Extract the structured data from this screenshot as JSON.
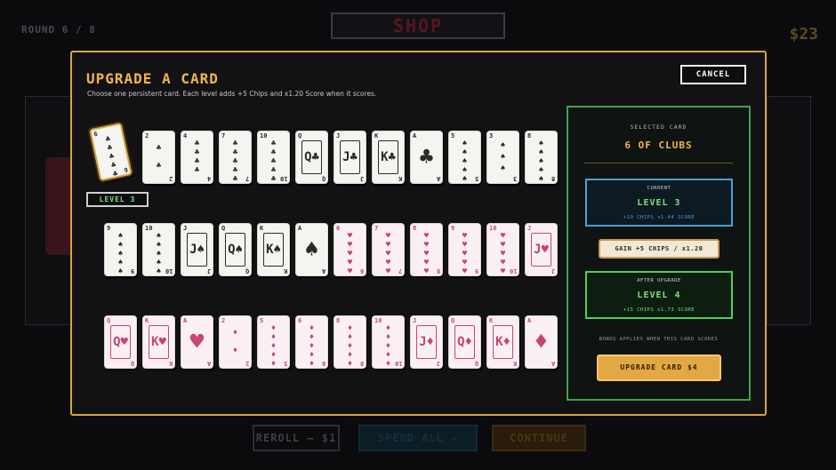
{
  "background": {
    "round": "ROUND 6 / 8",
    "shop_title": "SHOP",
    "money": "$23",
    "reroll": "REROLL — $1",
    "sell": "SPEND ALL →",
    "continue": "CONTINUE"
  },
  "modal": {
    "title": "UPGRADE A CARD",
    "subtitle": "Choose one persistent card. Each level adds +5 Chips and x1.20 Score when it scores.",
    "cancel": "CANCEL",
    "selected_level_tag": "LEVEL 3"
  },
  "cards": {
    "row1": [
      {
        "rank": "6",
        "suit": "♣",
        "color": "black",
        "kind": "pips",
        "pips": 6,
        "selected": true
      },
      {
        "rank": "2",
        "suit": "♣",
        "color": "black",
        "kind": "pips",
        "pips": 2
      },
      {
        "rank": "4",
        "suit": "♣",
        "color": "black",
        "kind": "pips",
        "pips": 4
      },
      {
        "rank": "7",
        "suit": "♣",
        "color": "black",
        "kind": "pips",
        "pips": 7
      },
      {
        "rank": "10",
        "suit": "♣",
        "color": "black",
        "kind": "pips",
        "pips": 10
      },
      {
        "rank": "Q",
        "suit": "♣",
        "color": "black",
        "kind": "face"
      },
      {
        "rank": "J",
        "suit": "♣",
        "color": "black",
        "kind": "face"
      },
      {
        "rank": "K",
        "suit": "♣",
        "color": "black",
        "kind": "face"
      },
      {
        "rank": "A",
        "suit": "♣",
        "color": "black",
        "kind": "ace"
      },
      {
        "rank": "5",
        "suit": "♠",
        "color": "black",
        "kind": "pips",
        "pips": 5
      },
      {
        "rank": "3",
        "suit": "♠",
        "color": "black",
        "kind": "pips",
        "pips": 3
      },
      {
        "rank": "8",
        "suit": "♠",
        "color": "black",
        "kind": "pips",
        "pips": 8
      }
    ],
    "row2": [
      {
        "rank": "9",
        "suit": "♠",
        "color": "black",
        "kind": "pips",
        "pips": 9
      },
      {
        "rank": "10",
        "suit": "♠",
        "color": "black",
        "kind": "pips",
        "pips": 10
      },
      {
        "rank": "J",
        "suit": "♠",
        "color": "black",
        "kind": "face"
      },
      {
        "rank": "Q",
        "suit": "♠",
        "color": "black",
        "kind": "face"
      },
      {
        "rank": "K",
        "suit": "♠",
        "color": "black",
        "kind": "face"
      },
      {
        "rank": "A",
        "suit": "♠",
        "color": "black",
        "kind": "ace"
      },
      {
        "rank": "6",
        "suit": "♥",
        "color": "red",
        "kind": "pips",
        "pips": 6
      },
      {
        "rank": "7",
        "suit": "♥",
        "color": "red",
        "kind": "pips",
        "pips": 7
      },
      {
        "rank": "8",
        "suit": "♥",
        "color": "red",
        "kind": "pips",
        "pips": 8
      },
      {
        "rank": "9",
        "suit": "♥",
        "color": "red",
        "kind": "pips",
        "pips": 9
      },
      {
        "rank": "10",
        "suit": "♥",
        "color": "red",
        "kind": "pips",
        "pips": 10
      },
      {
        "rank": "J",
        "suit": "♥",
        "color": "red",
        "kind": "face"
      }
    ],
    "row3": [
      {
        "rank": "Q",
        "suit": "♥",
        "color": "red",
        "kind": "face"
      },
      {
        "rank": "K",
        "suit": "♥",
        "color": "red",
        "kind": "face"
      },
      {
        "rank": "A",
        "suit": "♥",
        "color": "red",
        "kind": "ace"
      },
      {
        "rank": "2",
        "suit": "♦",
        "color": "red",
        "kind": "pips",
        "pips": 2
      },
      {
        "rank": "5",
        "suit": "♦",
        "color": "red",
        "kind": "pips",
        "pips": 5
      },
      {
        "rank": "6",
        "suit": "♦",
        "color": "red",
        "kind": "pips",
        "pips": 6
      },
      {
        "rank": "8",
        "suit": "♦",
        "color": "red",
        "kind": "pips",
        "pips": 8
      },
      {
        "rank": "10",
        "suit": "♦",
        "color": "red",
        "kind": "pips",
        "pips": 10
      },
      {
        "rank": "J",
        "suit": "♦",
        "color": "red",
        "kind": "face"
      },
      {
        "rank": "Q",
        "suit": "♦",
        "color": "red",
        "kind": "face"
      },
      {
        "rank": "K",
        "suit": "♦",
        "color": "red",
        "kind": "face"
      },
      {
        "rank": "A",
        "suit": "♦",
        "color": "red",
        "kind": "ace"
      }
    ]
  },
  "side_panel": {
    "selected_label": "SELECTED CARD",
    "selected_name": "6 OF CLUBS",
    "current": {
      "label": "CURRENT",
      "level": "LEVEL 3",
      "stats": "+10 CHIPS   x1.44 SCORE"
    },
    "gain": "GAIN +5 CHIPS / x1.20",
    "after": {
      "label": "AFTER UPGRADE",
      "level": "LEVEL 4",
      "stats": "+15 CHIPS   x1.73 SCORE"
    },
    "bonus_note": "BONUS APPLIES WHEN THIS CARD SCORES",
    "upgrade_button": "UPGRADE CARD   $4"
  },
  "colors": {
    "accent_gold": "#d9a441",
    "panel_green": "#3fa34a",
    "current_blue": "#4a9fd8",
    "red_suit": "#c8466e"
  }
}
